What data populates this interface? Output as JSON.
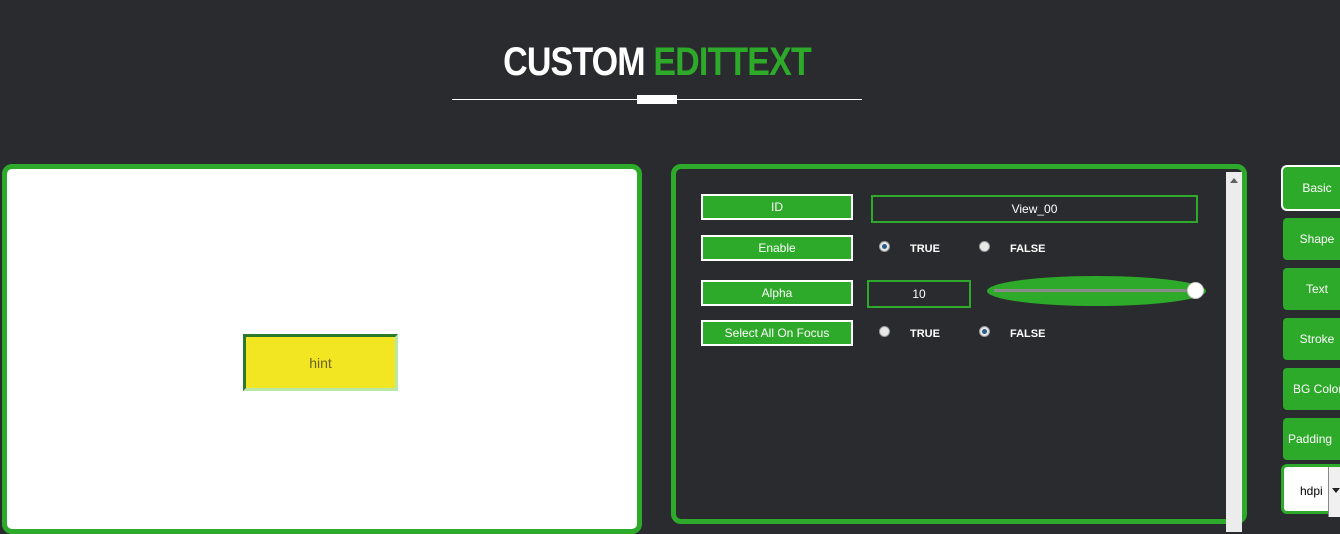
{
  "header": {
    "title_part1": "CUSTOM",
    "title_part2": "EDITTEXT"
  },
  "preview": {
    "edittext_hint": "hint",
    "edittext_background": "#f2e622"
  },
  "properties": {
    "id_label": "ID",
    "id_value": "View_00",
    "enable_label": "Enable",
    "enable_true": "TRUE",
    "enable_false": "FALSE",
    "enable_selected": "TRUE",
    "alpha_label": "Alpha",
    "alpha_value": "10",
    "alpha_slider_fraction": 1.0,
    "select_all_label": "Select All On Focus",
    "select_all_true": "TRUE",
    "select_all_false": "FALSE",
    "select_all_selected": "FALSE"
  },
  "tabs": [
    {
      "label": "Basic",
      "active": true
    },
    {
      "label": "Shape",
      "active": false
    },
    {
      "label": "Text",
      "active": false
    },
    {
      "label": "Stroke",
      "active": false
    },
    {
      "label": "BG Color",
      "active": false
    },
    {
      "label": "Padding",
      "active": false
    }
  ],
  "dpi_select": {
    "selected": "hdpi"
  },
  "colors": {
    "accent": "#2eaa2a",
    "background": "#2a2b2e"
  }
}
